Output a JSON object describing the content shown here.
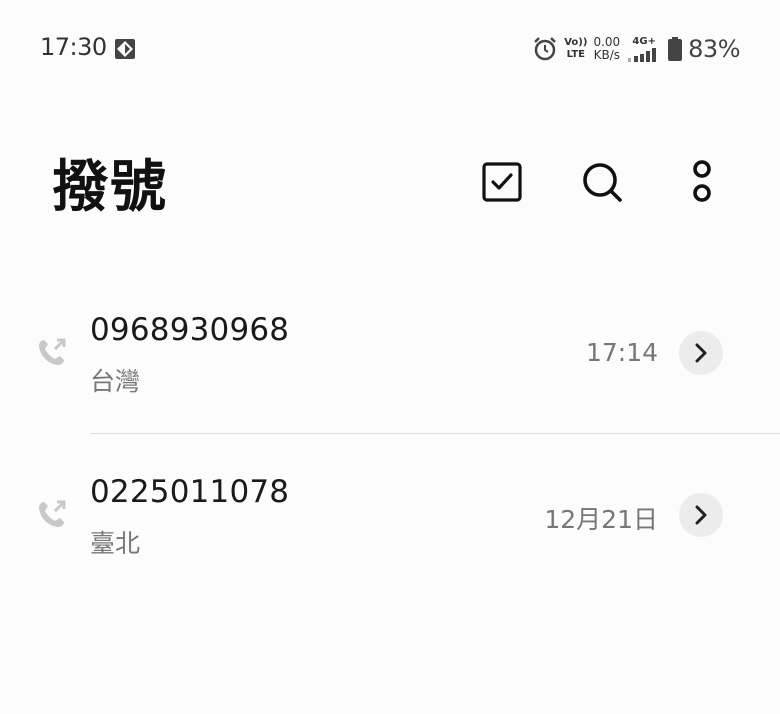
{
  "status_bar": {
    "time": "17:30",
    "volte_top": "Vo))",
    "volte_bottom": "LTE",
    "net_speed_value": "0.00",
    "net_speed_unit": "KB/s",
    "network_type": "4G+",
    "battery_percent": "83%",
    "icons": [
      "app-notification-icon",
      "alarm-icon",
      "signal-icon",
      "battery-icon"
    ]
  },
  "header": {
    "title": "撥號",
    "actions": [
      {
        "name": "select-icon"
      },
      {
        "name": "search-icon"
      },
      {
        "name": "more-icon"
      }
    ]
  },
  "calls": [
    {
      "number": "0968930968",
      "location": "台灣",
      "time": "17:14",
      "type": "outgoing"
    },
    {
      "number": "0225011078",
      "location": "臺北",
      "time": "12月21日",
      "type": "outgoing"
    }
  ],
  "colors": {
    "background": "#fcfcfc",
    "text_primary": "#1a1a1a",
    "text_secondary": "#777777",
    "detail_button_bg": "#ececec"
  }
}
